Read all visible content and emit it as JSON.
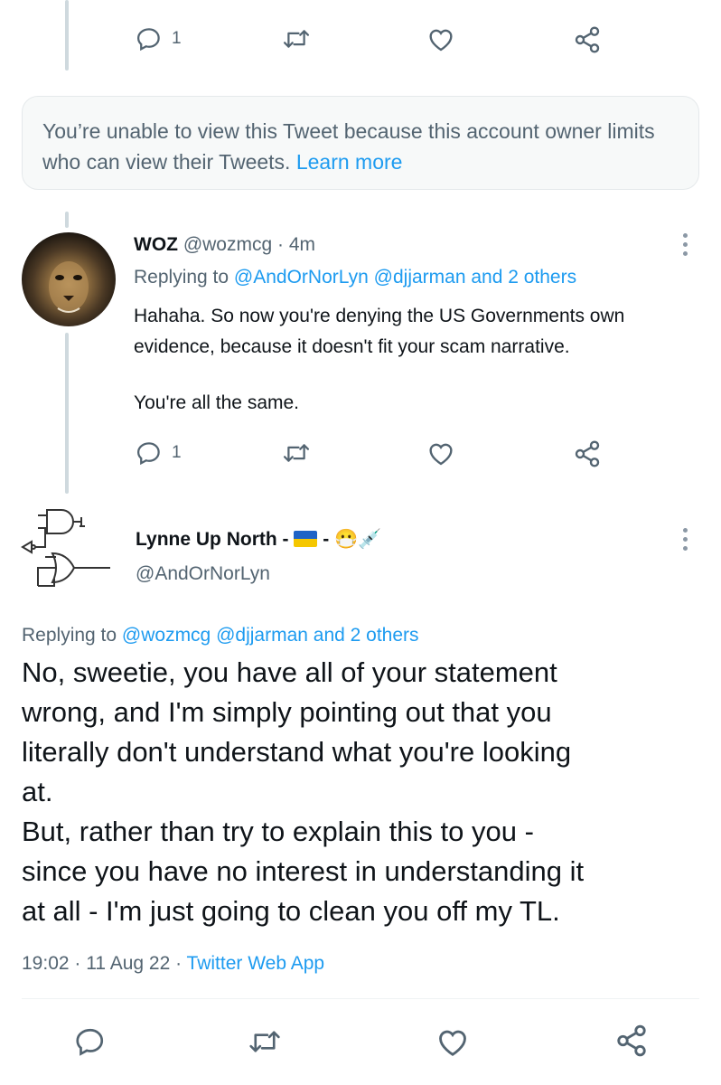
{
  "top_actions": {
    "reply_count": "1"
  },
  "restricted_notice": {
    "text": "You’re unable to view this Tweet because this account owner limits who can view their Tweets.",
    "link": "Learn more"
  },
  "reply_tweet": {
    "display_name": "WOZ",
    "handle": "@wozmcg",
    "separator": "·",
    "time": "4m",
    "replying_prefix": "Replying to",
    "replying_users": "@AndOrNorLyn @djjarman and 2 others",
    "text_line1": "Hahaha. So now you're denying the US Governments own",
    "text_line2": "evidence, because it doesn't fit your scam narrative.",
    "text_line3": "You're all the same.",
    "reply_count": "1",
    "avatar_icon": "lion-avatar"
  },
  "main_tweet": {
    "display_name": "Lynne Up North -",
    "name_dash2": "-",
    "flag_icon": "ukraine-flag-icon",
    "emoji_mask": "😷",
    "emoji_syringe": "💉",
    "handle": "@AndOrNorLyn",
    "replying_prefix": "Replying to",
    "replying_users": "@wozmcg @djjarman and 2 others",
    "lines": [
      "No, sweetie, you have all of your statement",
      "wrong, and I'm simply pointing out that you",
      "literally don't understand what you're looking",
      "at.",
      "But, rather than try to explain this to you -",
      "since you have no interest in understanding it",
      "at all - I'm just going to clean you off my TL."
    ],
    "timestamp": "19:02 · 11 Aug 22 ·",
    "source": "Twitter Web App",
    "avatar_icon": "logic-gate-avatar"
  },
  "colors": {
    "link": "#1d9bf0",
    "muted": "#536471",
    "text": "#0f1419",
    "thread_line": "#cfd9de"
  }
}
